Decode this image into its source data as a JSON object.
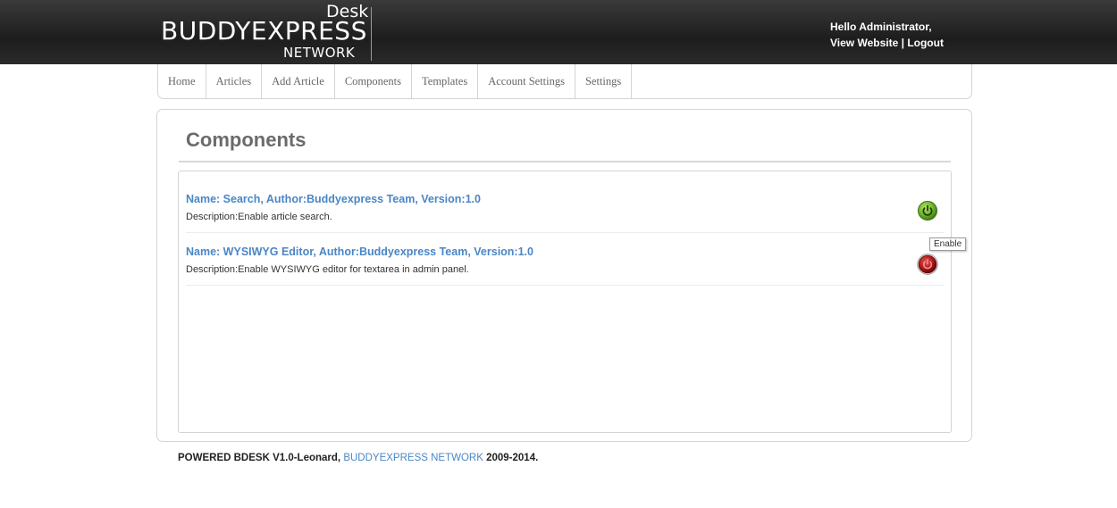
{
  "header": {
    "logo": {
      "desk": "Desk",
      "main": "BUDDYEXPRESS",
      "network": "NETWORK"
    },
    "greeting": "Hello Administrator,",
    "view_website": "View Website",
    "separator": "|",
    "logout": "Logout"
  },
  "nav": {
    "items": [
      {
        "label": "Home"
      },
      {
        "label": "Articles"
      },
      {
        "label": "Add Article"
      },
      {
        "label": "Components"
      },
      {
        "label": "Templates"
      },
      {
        "label": "Account Settings"
      },
      {
        "label": "Settings"
      }
    ]
  },
  "page": {
    "title": "Components"
  },
  "components": [
    {
      "name": "Name: Search, Author:Buddyexpress Team, Version:1.0",
      "description": "Description:Enable article search.",
      "status": "enabled",
      "status_color": "#6fb52c"
    },
    {
      "name": "Name: WYSIWYG Editor, Author:Buddyexpress Team, Version:1.0",
      "description": "Description:Enable WYSIWYG editor for textarea in admin panel.",
      "status": "disabled",
      "status_color": "#b01c1c"
    }
  ],
  "tooltip": {
    "text": "Enable"
  },
  "footer": {
    "prefix": "POWERED BDESK V1.0-Leonard,",
    "link": "BUDDYEXPRESS NETWORK",
    "suffix": "2009-2014."
  }
}
